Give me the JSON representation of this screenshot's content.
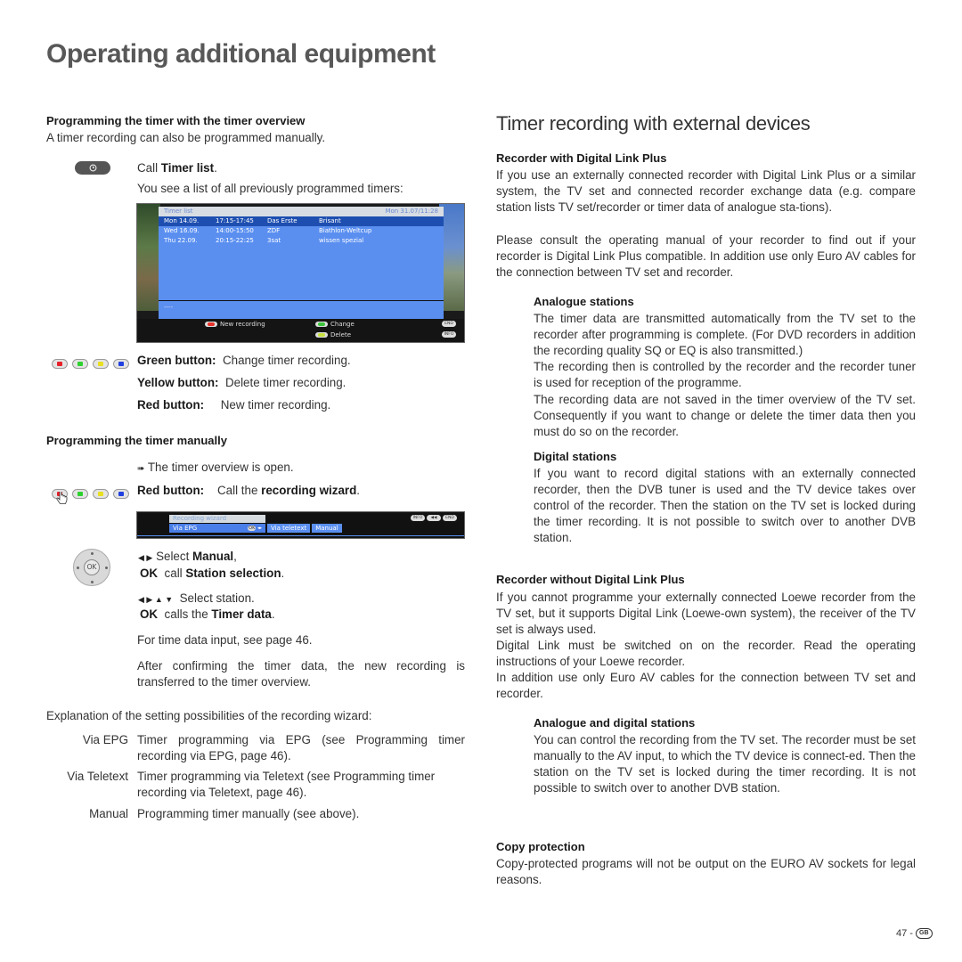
{
  "page": {
    "title": "Operating additional equipment",
    "page_number": "47 -",
    "country_badge": "GB"
  },
  "left": {
    "section1": {
      "heading": "Programming the timer with the timer overview",
      "intro": "A timer recording can also be programmed manually.",
      "step1_prefix": "Call ",
      "step1_bold": "Timer list",
      "step1_suffix": ".",
      "step1_desc": "You see a list of all previously programmed timers:",
      "timer_button_icon": "clock-icon"
    },
    "timer_list_screen": {
      "header_title": "Timer list",
      "header_datetime": "Mon 31.07/11:28",
      "rows": [
        {
          "day": "Mon 14.09.",
          "time": "17:15-17:45",
          "station": "Das Erste",
          "title": "Brisant",
          "selected": true
        },
        {
          "day": "Wed 16.09.",
          "time": "14:00-15:50",
          "station": "ZDF",
          "title": "Biathlon-Weltcup",
          "selected": false
        },
        {
          "day": "Thu  22.09.",
          "time": "20:15-22:25",
          "station": "3sat",
          "title": "wissen spezial",
          "selected": false
        }
      ],
      "info_line": "----",
      "legend": {
        "new_recording": "New recording",
        "change": "Change",
        "delete": "Delete",
        "end_key": "END",
        "info_key": "INFO"
      },
      "colors": {
        "red": "#e8332a",
        "green": "#3cc43c",
        "yellow": "#c8e040"
      }
    },
    "color_buttons": {
      "colors": [
        "#e8202a",
        "#2ed22e",
        "#e8e020",
        "#2040e0"
      ],
      "green_label": "Green button:",
      "green_desc": "Change timer recording.",
      "yellow_label": "Yellow button:",
      "yellow_desc": "Delete timer recording.",
      "red_label": "Red button:",
      "red_desc": "New timer recording."
    },
    "section2": {
      "heading": "Programming the timer manually",
      "precondition": "The timer overview is open.",
      "red_label": "Red button:",
      "red_desc_prefix": "Call the ",
      "red_desc_bold": "recording wizard",
      "red_desc_suffix": "."
    },
    "wizard_screen": {
      "title": "Recording wizard",
      "tabs": [
        "Via EPG",
        "Via teletext",
        "Manual"
      ],
      "ok_key": "OK",
      "keys": [
        "INFO",
        "◀◀",
        "END"
      ]
    },
    "nav": {
      "ok_label": "OK",
      "step_a_prefix": "Select ",
      "step_a_bold": "Manual",
      "step_a_suffix": ",",
      "step_b_ok": "OK",
      "step_b_prefix": "call ",
      "step_b_bold": "Station selection",
      "step_b_suffix": ".",
      "step_c": "Select station.",
      "step_d_ok": "OK",
      "step_d_prefix": "calls the ",
      "step_d_bold": "Timer data",
      "step_d_suffix": "."
    },
    "para_time_data": "For time data input, see page 46.",
    "para_after_confirm": "After confirming the timer data, the new recording is transferred to the timer overview.",
    "explanation": "Explanation of the setting possibilities of the recording wizard:",
    "definitions": [
      {
        "term": "Via EPG",
        "desc": "Timer programming via EPG (see Programming timer recording via EPG, page 46)."
      },
      {
        "term": "Via Teletext",
        "desc": "Timer programming via Teletext (see Programming timer recording via Teletext, page 46)."
      },
      {
        "term": "Manual",
        "desc": "Programming timer manually (see above)."
      }
    ]
  },
  "right": {
    "heading": "Timer recording with external devices",
    "dlp": {
      "heading": "Recorder with Digital Link Plus",
      "p1": "If you use an externally connected recorder with Digital Link Plus or a similar system, the TV set and connected recorder exchange data (e.g. compare station lists TV set/recorder or timer data of analogue sta-tions).",
      "p2": "Please consult the operating manual of your recorder to find out if your recorder is Digital Link Plus compatible. In addition use only Euro AV cables for the connection between TV set and recorder."
    },
    "analogue": {
      "heading": "Analogue stations",
      "p1": "The timer data are transmitted automatically from the TV set to the recorder after programming is complete. (For DVD recorders in addition the recording quality SQ or EQ is also transmitted.)",
      "p2": "The recording then is controlled by the recorder and the recorder tuner is used for reception of the programme.",
      "p3": "The recording data are not saved in the timer overview of the TV set. Consequently if you want to change or delete the timer data then you must do so on the recorder."
    },
    "digital": {
      "heading": "Digital stations",
      "p1": "If you want to record digital stations with an externally connected recorder, then the DVB tuner is used and the TV device takes over control of the recorder. Then the station on the TV set is locked during the timer recording. It is not possible to switch over to another DVB station."
    },
    "no_dlp": {
      "heading": "Recorder without Digital Link Plus",
      "p1": "If you cannot programme your externally connected Loewe recorder from the TV set, but it supports Digital Link (Loewe-own system), the receiver of the TV set is always used.",
      "p2": "Digital Link must be switched on on the recorder. Read the operating instructions of your Loewe recorder.",
      "p3": "In addition use only Euro AV cables for the connection between TV set and recorder."
    },
    "analogue_digital": {
      "heading": "Analogue and digital stations",
      "p1": "You can control the recording from the TV set. The recorder must be set manually to the AV input, to which the TV device is connect-ed. Then the station on the TV set is locked during the timer recording. It is not possible to switch over to another DVB station."
    },
    "copy": {
      "heading": "Copy protection",
      "p1": "Copy-protected programs will not be output on the EURO AV sockets for legal reasons."
    }
  }
}
